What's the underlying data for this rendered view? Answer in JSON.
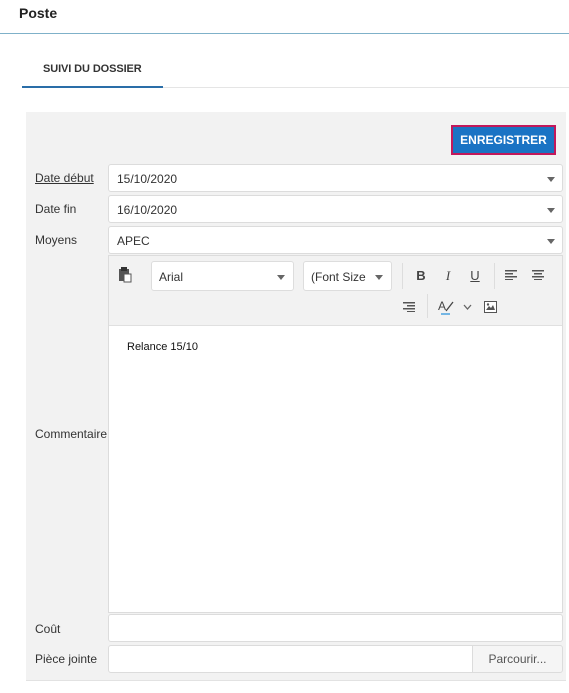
{
  "header": {
    "title": "Poste"
  },
  "tabs": [
    {
      "label": "SUIVI DU DOSSIER",
      "active": true
    }
  ],
  "form": {
    "save_label": "ENREGISTRER",
    "date_debut": {
      "label": "Date début",
      "value": "15/10/2020"
    },
    "date_fin": {
      "label": "Date fin",
      "value": "16/10/2020"
    },
    "moyens": {
      "label": "Moyens",
      "value": "APEC"
    },
    "commentaire": {
      "label": "Commentaire",
      "font": "Arial",
      "font_size_placeholder": "(Font Size",
      "content": "Relance 15/10"
    },
    "cout": {
      "label": "Coût",
      "value": ""
    },
    "piece_jointe": {
      "label": "Pièce jointe",
      "value": "",
      "browse_label": "Parcourir..."
    }
  },
  "colors": {
    "accent": "#1a73c4",
    "focus_border": "#c2185b",
    "tab_underline": "#2a6ea8"
  },
  "icons": [
    "paste-icon",
    "bold-icon",
    "italic-icon",
    "underline-icon",
    "align-left-icon",
    "align-center-icon",
    "align-right-icon",
    "spellcheck-icon",
    "chevron-down-icon",
    "image-icon"
  ]
}
